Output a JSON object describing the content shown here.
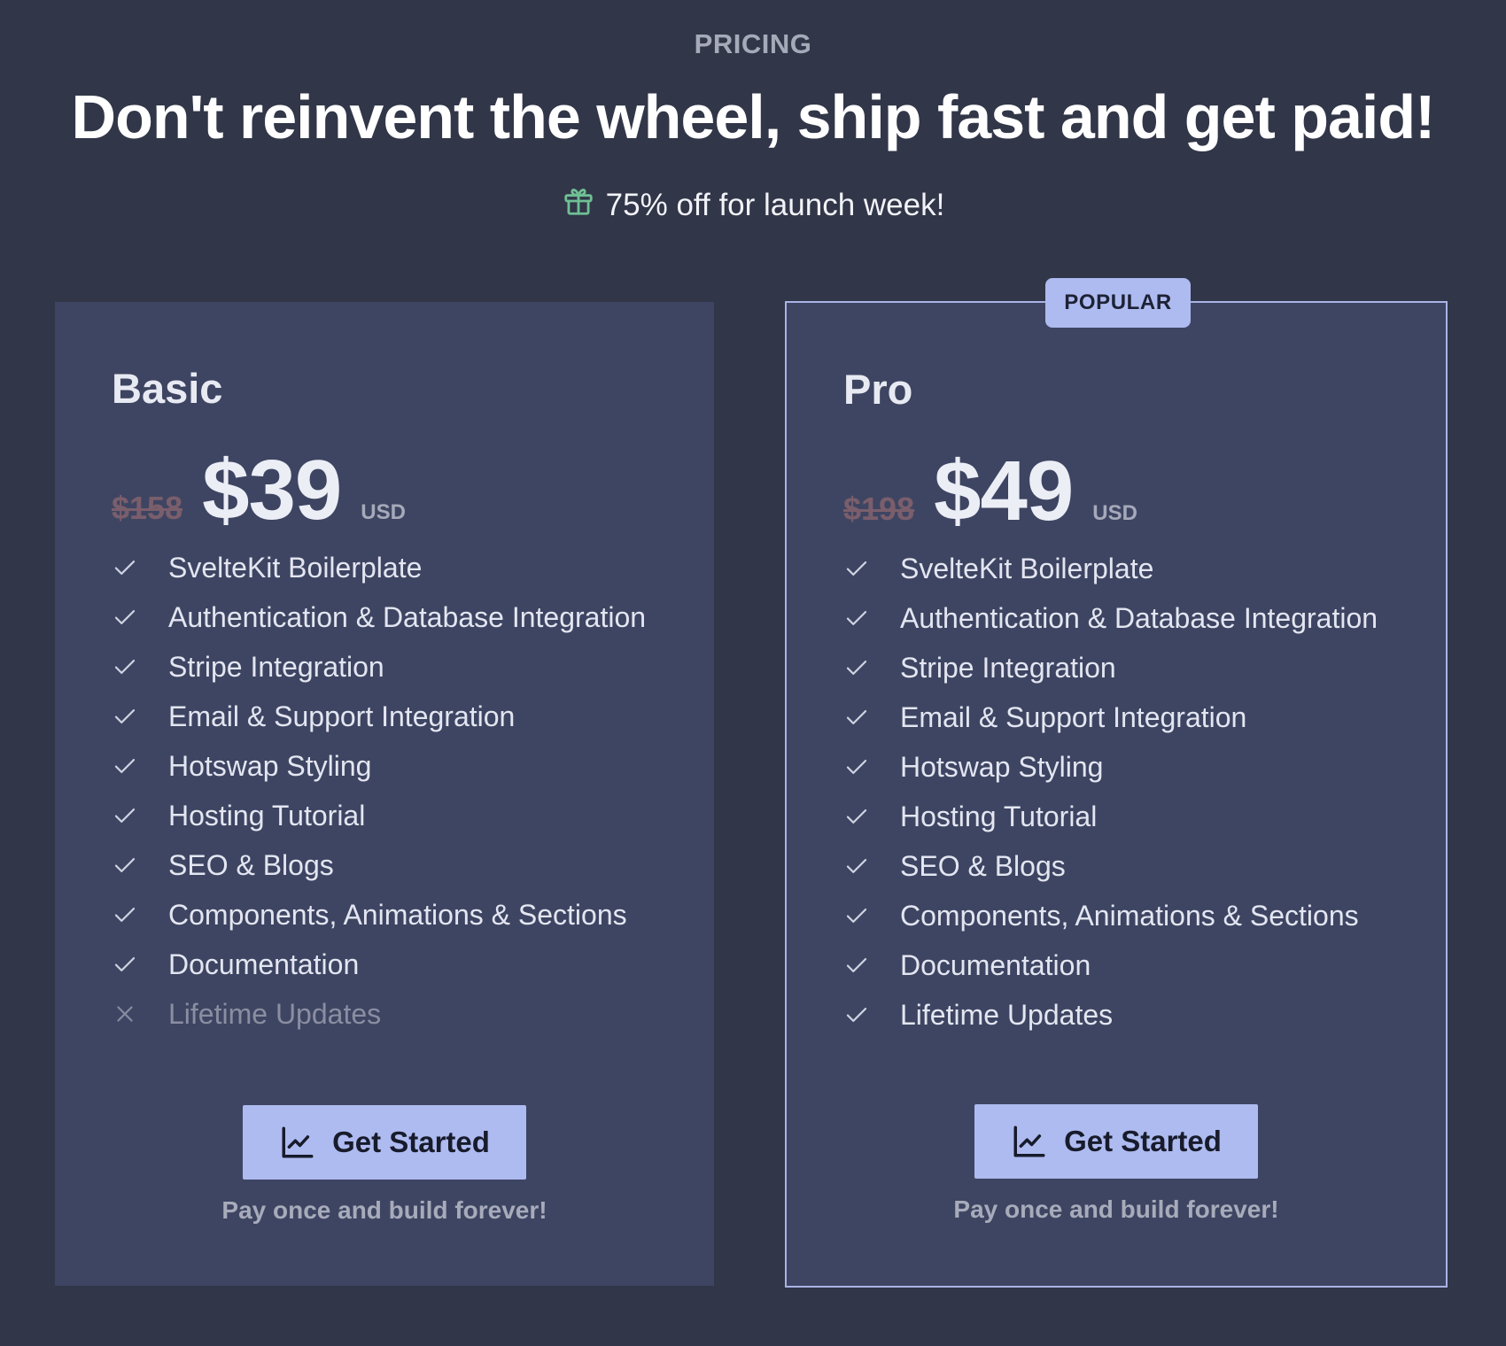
{
  "header": {
    "eyebrow": "PRICING",
    "headline": "Don't reinvent the wheel, ship fast and get paid!",
    "promo_text": "75% off for launch week!",
    "promo_icon": "gift-icon"
  },
  "colors": {
    "page_background": "#313648",
    "card_background": "#3e4562",
    "accent": "#aebbf0",
    "promo_icon": "#6fbf95",
    "old_price": "#7a5e6c"
  },
  "plans": [
    {
      "name": "Basic",
      "old_price": "$158",
      "price": "$39",
      "currency": "USD",
      "highlighted": false,
      "features": [
        {
          "label": "SvelteKit Boilerplate",
          "included": true
        },
        {
          "label": "Authentication & Database Integration",
          "included": true
        },
        {
          "label": "Stripe Integration",
          "included": true
        },
        {
          "label": "Email & Support Integration",
          "included": true
        },
        {
          "label": "Hotswap Styling",
          "included": true
        },
        {
          "label": "Hosting Tutorial",
          "included": true
        },
        {
          "label": "SEO & Blogs",
          "included": true
        },
        {
          "label": "Components, Animations & Sections",
          "included": true
        },
        {
          "label": "Documentation",
          "included": true
        },
        {
          "label": "Lifetime Updates",
          "included": false
        }
      ],
      "cta_label": "Get Started",
      "cta_icon": "chart-line-icon",
      "note": "Pay once and build forever!"
    },
    {
      "name": "Pro",
      "badge": "POPULAR",
      "old_price": "$198",
      "price": "$49",
      "currency": "USD",
      "highlighted": true,
      "features": [
        {
          "label": "SvelteKit Boilerplate",
          "included": true
        },
        {
          "label": "Authentication & Database Integration",
          "included": true
        },
        {
          "label": "Stripe Integration",
          "included": true
        },
        {
          "label": "Email & Support Integration",
          "included": true
        },
        {
          "label": "Hotswap Styling",
          "included": true
        },
        {
          "label": "Hosting Tutorial",
          "included": true
        },
        {
          "label": "SEO & Blogs",
          "included": true
        },
        {
          "label": "Components, Animations & Sections",
          "included": true
        },
        {
          "label": "Documentation",
          "included": true
        },
        {
          "label": "Lifetime Updates",
          "included": true
        }
      ],
      "cta_label": "Get Started",
      "cta_icon": "chart-line-icon",
      "note": "Pay once and build forever!"
    }
  ]
}
